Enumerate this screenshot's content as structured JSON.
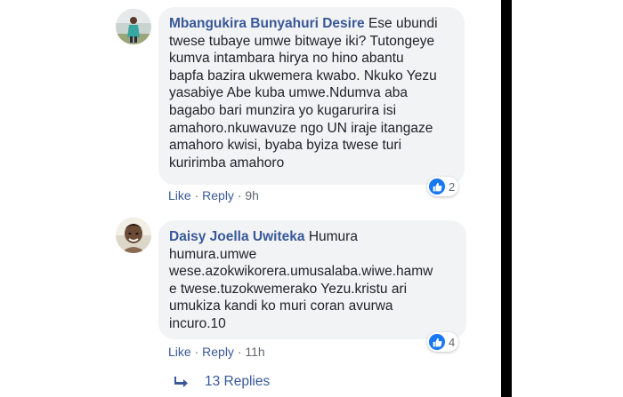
{
  "comments": [
    {
      "author": "Mbangukira Bunyahuri Desire",
      "lines": [
        "Ese ubundi",
        "twese tubaye umwe bitwaye iki? Tutongeye",
        "kumva intambara hirya no hino abantu",
        "bapfa bazira ukwemera kwabo. Nkuko Yezu",
        "yasabiye Abe kuba umwe.Ndumva aba",
        "bagabo bari munzira yo kugarurira isi",
        "amahoro.nkuwavuze ngo UN iraje itangaze",
        "amahoro kwisi, byaba byiza twese turi",
        "kuririmba amahoro"
      ],
      "like_label": "Like",
      "reply_label": "Reply",
      "time": "9h",
      "reaction_count": "2",
      "avatar_icon": "user-avatar-icon"
    },
    {
      "author": "Daisy Joella Uwiteka",
      "lines": [
        "Humura",
        "humura.umwe",
        "wese.azokwikorera.umusalaba.wiwe.hamw",
        "e twese.tuzokwemerako Yezu.kristu ari",
        "umukiza kandi ko muri coran avurwa",
        "incuro.10"
      ],
      "like_label": "Like",
      "reply_label": "Reply",
      "time": "11h",
      "reaction_count": "4",
      "avatar_icon": "user-avatar-icon"
    }
  ],
  "replies": {
    "label": "13 Replies",
    "icon": "reply-arrow-icon"
  },
  "colors": {
    "link": "#385898",
    "bubble": "#f2f3f5",
    "like": "#1877f2"
  }
}
